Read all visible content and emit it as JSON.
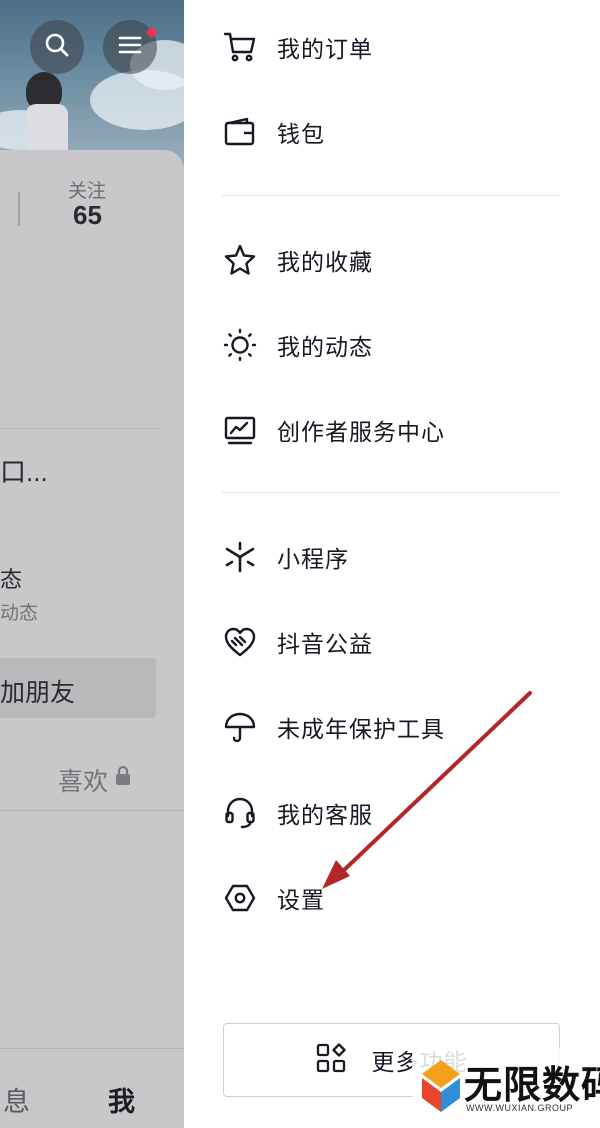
{
  "profile_panel": {
    "follow_label": "关注",
    "follow_count": "65",
    "bio_fragment": "口...",
    "dynamics_title": "态",
    "dynamics_subtitle": "动态",
    "add_friend_label": "加朋友",
    "likes_tab": "喜欢",
    "bottom_nav": {
      "messages": "息",
      "me": "我"
    },
    "colors": {
      "notification_dot": "#fe2c55"
    }
  },
  "drawer": {
    "items": [
      {
        "icon": "shopping-cart-icon",
        "label": "我的订单"
      },
      {
        "icon": "wallet-icon",
        "label": "钱包"
      },
      {
        "icon": "star-icon",
        "label": "我的收藏"
      },
      {
        "icon": "sun-icon",
        "label": "我的动态"
      },
      {
        "icon": "monitor-chart-icon",
        "label": "创作者服务中心"
      },
      {
        "icon": "mini-program-icon",
        "label": "小程序"
      },
      {
        "icon": "heart-charity-icon",
        "label": "抖音公益"
      },
      {
        "icon": "umbrella-icon",
        "label": "未成年保护工具"
      },
      {
        "icon": "headset-icon",
        "label": "我的客服"
      },
      {
        "icon": "hexagon-settings-icon",
        "label": "设置"
      }
    ],
    "more_button": {
      "icon": "grid-apps-icon",
      "label": "更多功能"
    }
  },
  "annotation": {
    "color": "#b3262a"
  },
  "watermark": {
    "brand": "无限数码",
    "sub": "WWW.WUXIAN.GROUP"
  }
}
